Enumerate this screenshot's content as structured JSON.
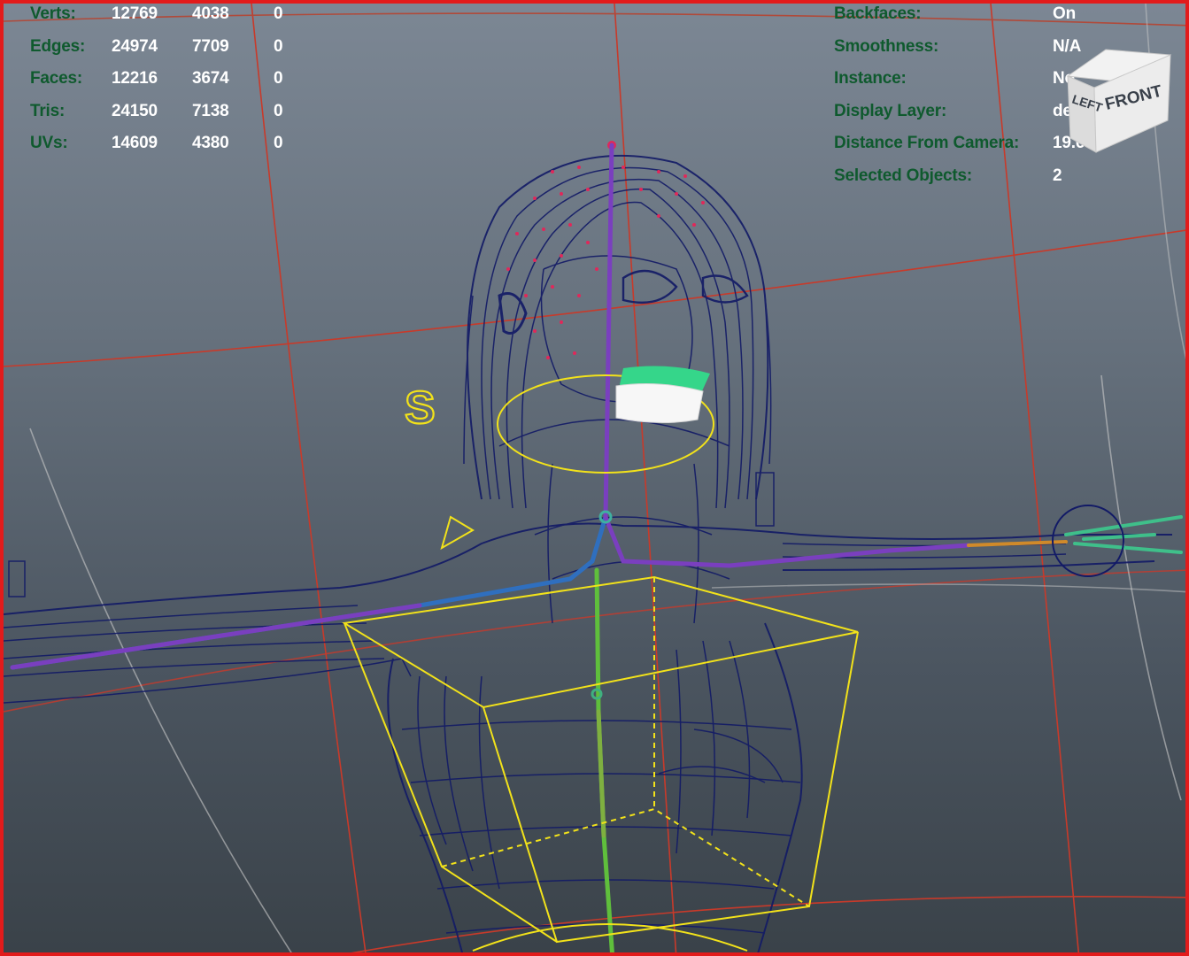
{
  "stats": {
    "rows": [
      {
        "label": "Verts:",
        "values": [
          "12769",
          "4038",
          "0"
        ]
      },
      {
        "label": "Edges:",
        "values": [
          "24974",
          "7709",
          "0"
        ]
      },
      {
        "label": "Faces:",
        "values": [
          "12216",
          "3674",
          "0"
        ]
      },
      {
        "label": "Tris:",
        "values": [
          "24150",
          "7138",
          "0"
        ]
      },
      {
        "label": "UVs:",
        "values": [
          "14609",
          "4380",
          "0"
        ]
      }
    ]
  },
  "object_info": {
    "rows": [
      {
        "label": "Backfaces:",
        "value": "On"
      },
      {
        "label": "Smoothness:",
        "value": "N/A"
      },
      {
        "label": "Instance:",
        "value": "No"
      },
      {
        "label": "Display Layer:",
        "value": "default"
      },
      {
        "label": "Distance From Camera:",
        "value": "19.681"
      },
      {
        "label": "Selected Objects:",
        "value": "2"
      }
    ]
  },
  "view_cube": {
    "front_label": "FRONT",
    "left_label": "LEFT"
  },
  "scene": {
    "control_letter": "S",
    "colors": {
      "viewport_border": "#e21b1b",
      "hud_label": "#0f5a2e",
      "hud_value": "#ffffff",
      "wireframe": "#121a66",
      "selection": "#f2e21a",
      "grid": "#d23a2a",
      "joint_hair": "#e0285a",
      "mouth_green": "#35d68a",
      "bone_spine": "#5fbf3c",
      "bone_arm": "#7a3fbf"
    }
  }
}
